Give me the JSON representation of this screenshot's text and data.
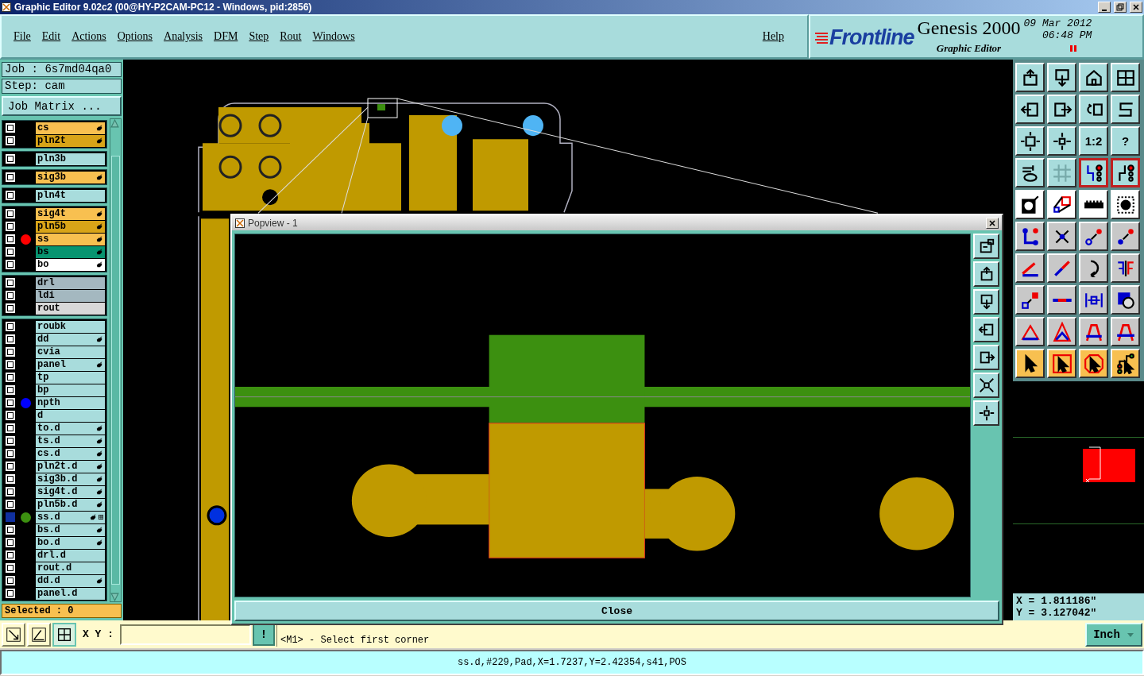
{
  "window": {
    "title": "Graphic Editor 9.02c2 (00@HY-P2CAM-PC12 - Windows, pid:2856)"
  },
  "menu": [
    "File",
    "Edit",
    "Actions",
    "Options",
    "Analysis",
    "DFM",
    "Step",
    "Rout",
    "Windows"
  ],
  "help": "Help",
  "brand": {
    "logo": "Frontline",
    "product": "Genesis 2000",
    "module": "Graphic Editor",
    "date": "09 Mar 2012",
    "time": "06:48 PM"
  },
  "job": "Job : 6s7md04qa0",
  "step": "Step: cam",
  "job_matrix_button": "Job Matrix ...",
  "layer_groups": [
    [
      {
        "name": "cs",
        "color": "#f8c050",
        "edit": true,
        "grid_mark": false,
        "selected": false
      },
      {
        "name": "pln2t",
        "color": "#d8a418",
        "edit": true,
        "grid_mark": false,
        "selected": false
      }
    ],
    [
      {
        "name": "pln3b",
        "color": "#a8dcdc",
        "edit": false,
        "grid_mark": false,
        "selected": false
      }
    ],
    [
      {
        "name": "sig3b",
        "color": "#f8c050",
        "edit": true,
        "grid_mark": false,
        "selected": false
      }
    ],
    [
      {
        "name": "pln4t",
        "color": "#a8dcdc",
        "edit": false,
        "grid_mark": false,
        "selected": false
      }
    ],
    [
      {
        "name": "sig4t",
        "color": "#f8c050",
        "edit": true,
        "grid_mark": false,
        "selected": false
      },
      {
        "name": "pln5b",
        "color": "#d8a418",
        "edit": true,
        "grid_mark": false,
        "selected": false
      },
      {
        "name": "ss",
        "color": "#f8c050",
        "edit": true,
        "grid_mark": false,
        "selected": false,
        "marker": {
          "color": "#ff0000"
        }
      },
      {
        "name": "bs",
        "color": "#089470",
        "edit": true,
        "grid_mark": false,
        "selected": false
      },
      {
        "name": "bo",
        "color": "#ffffff",
        "edit": true,
        "grid_mark": false,
        "selected": false
      }
    ],
    [
      {
        "name": "drl",
        "color": "#a4b8c0",
        "edit": false,
        "grid_mark": false,
        "selected": false
      },
      {
        "name": "ldi",
        "color": "#a4b8c0",
        "edit": false,
        "grid_mark": false,
        "selected": false
      },
      {
        "name": "rout",
        "color": "#d8d8d8",
        "edit": false,
        "grid_mark": false,
        "selected": false
      }
    ],
    [
      {
        "name": "roubk",
        "color": "#a8dcdc",
        "edit": false,
        "grid_mark": false,
        "selected": false
      },
      {
        "name": "dd",
        "color": "#a8dcdc",
        "edit": true,
        "grid_mark": false,
        "selected": false
      },
      {
        "name": "cvia",
        "color": "#a8dcdc",
        "edit": false,
        "grid_mark": false,
        "selected": false
      },
      {
        "name": "panel",
        "color": "#a8dcdc",
        "edit": true,
        "grid_mark": false,
        "selected": false
      },
      {
        "name": "tp",
        "color": "#a8dcdc",
        "edit": false,
        "grid_mark": false,
        "selected": false
      },
      {
        "name": "bp",
        "color": "#a8dcdc",
        "edit": false,
        "grid_mark": false,
        "selected": false
      },
      {
        "name": "npth",
        "color": "#a8dcdc",
        "edit": false,
        "grid_mark": false,
        "selected": false,
        "marker": {
          "color": "#0000ff"
        }
      },
      {
        "name": "d",
        "color": "#a8dcdc",
        "edit": false,
        "grid_mark": false,
        "selected": false
      },
      {
        "name": "to.d",
        "color": "#a8dcdc",
        "edit": true,
        "grid_mark": false,
        "selected": false
      },
      {
        "name": "ts.d",
        "color": "#a8dcdc",
        "edit": true,
        "grid_mark": false,
        "selected": false
      },
      {
        "name": "cs.d",
        "color": "#a8dcdc",
        "edit": true,
        "grid_mark": false,
        "selected": false
      },
      {
        "name": "pln2t.d",
        "color": "#a8dcdc",
        "edit": true,
        "grid_mark": false,
        "selected": false
      },
      {
        "name": "sig3b.d",
        "color": "#a8dcdc",
        "edit": true,
        "grid_mark": false,
        "selected": false
      },
      {
        "name": "sig4t.d",
        "color": "#a8dcdc",
        "edit": true,
        "grid_mark": false,
        "selected": false
      },
      {
        "name": "pln5b.d",
        "color": "#a8dcdc",
        "edit": true,
        "grid_mark": false,
        "selected": false
      },
      {
        "name": "ss.d",
        "color": "#a8dcdc",
        "edit": true,
        "grid_mark": true,
        "selected": true,
        "marker": {
          "color": "#3c9010"
        }
      },
      {
        "name": "bs.d",
        "color": "#a8dcdc",
        "edit": true,
        "grid_mark": false,
        "selected": false
      },
      {
        "name": "bo.d",
        "color": "#a8dcdc",
        "edit": true,
        "grid_mark": false,
        "selected": false
      },
      {
        "name": "drl.d",
        "color": "#a8dcdc",
        "edit": false,
        "grid_mark": false,
        "selected": false
      },
      {
        "name": "rout.d",
        "color": "#a8dcdc",
        "edit": false,
        "grid_mark": false,
        "selected": false
      },
      {
        "name": "dd.d",
        "color": "#a8dcdc",
        "edit": true,
        "grid_mark": false,
        "selected": false
      },
      {
        "name": "panel.d",
        "color": "#a8dcdc",
        "edit": false,
        "grid_mark": false,
        "selected": false
      }
    ]
  ],
  "selected_count": "Selected : 0",
  "toolbar": [
    {
      "kind": "view",
      "selected": false
    },
    {
      "kind": "view",
      "selected": false
    },
    {
      "kind": "view",
      "selected": false
    },
    {
      "kind": "view",
      "selected": false
    },
    {
      "kind": "view",
      "selected": false
    },
    {
      "kind": "view",
      "selected": false
    },
    {
      "kind": "view",
      "selected": false
    },
    {
      "kind": "view",
      "selected": false
    },
    {
      "kind": "view",
      "selected": false
    },
    {
      "kind": "view",
      "selected": false
    },
    {
      "kind": "view",
      "selected": false,
      "label": "1:2"
    },
    {
      "kind": "view",
      "selected": false,
      "label": "?"
    },
    {
      "kind": "view",
      "selected": false
    },
    {
      "kind": "view",
      "selected": false
    },
    {
      "kind": "view",
      "selected": true
    },
    {
      "kind": "view",
      "selected": true
    },
    {
      "kind": "mode",
      "selected": false
    },
    {
      "kind": "mode",
      "selected": false
    },
    {
      "kind": "mode",
      "selected": false
    },
    {
      "kind": "mode",
      "selected": false
    },
    {
      "kind": "edit",
      "selected": false
    },
    {
      "kind": "edit",
      "selected": false
    },
    {
      "kind": "edit",
      "selected": false
    },
    {
      "kind": "edit",
      "selected": false
    },
    {
      "kind": "edit",
      "selected": false
    },
    {
      "kind": "edit",
      "selected": false
    },
    {
      "kind": "edit",
      "selected": false
    },
    {
      "kind": "edit",
      "selected": false
    },
    {
      "kind": "edit",
      "selected": false
    },
    {
      "kind": "edit",
      "selected": false
    },
    {
      "kind": "edit",
      "selected": false
    },
    {
      "kind": "edit",
      "selected": false
    },
    {
      "kind": "edit",
      "selected": false
    },
    {
      "kind": "edit",
      "selected": false
    },
    {
      "kind": "edit",
      "selected": false
    },
    {
      "kind": "edit",
      "selected": false
    },
    {
      "kind": "select",
      "selected": false
    },
    {
      "kind": "select",
      "selected": false
    },
    {
      "kind": "select",
      "selected": false
    },
    {
      "kind": "select",
      "selected": false
    }
  ],
  "coordinates": {
    "x": "X = 1.811186\"",
    "y": "Y = 3.127042\""
  },
  "popview": {
    "title": "Popview - 1",
    "close_button": "Close"
  },
  "xy_label": "X Y :",
  "prompt_button": "!",
  "prompt": "<M1> - Select first corner",
  "units": "Inch",
  "status": "ss.d,#229,Pad,X=1.7237,Y=2.42354,s41,POS"
}
